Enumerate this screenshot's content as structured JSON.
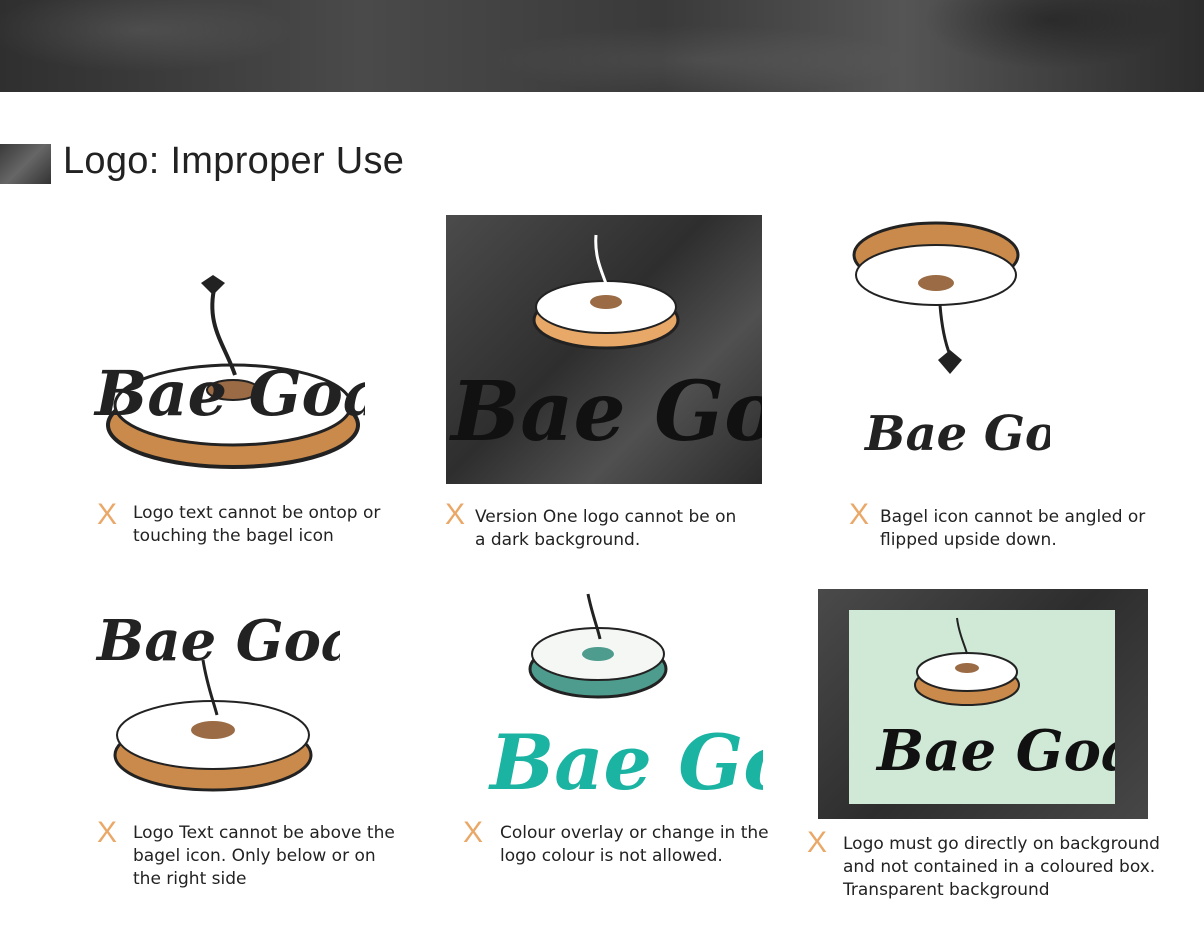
{
  "page": {
    "title": "Logo: Improper Use"
  },
  "logo_text": "Bae Goals",
  "colors": {
    "x_mark": "#eaa868",
    "bagel_crust": "#c98a4b",
    "bagel_cream": "#ffffff",
    "teal": "#1bb3a2",
    "mint_box": "#cfe9d6",
    "dark_background": "#3a3a3a"
  },
  "rules": [
    {
      "mark": "X",
      "text_line1": "Logo text cannot be ontop or",
      "text_line2": "touching the bagel icon",
      "text_line3": ""
    },
    {
      "mark": "X",
      "text_line1": "Version One logo cannot be on",
      "text_line2": "a dark background.",
      "text_line3": ""
    },
    {
      "mark": "X",
      "text_line1": "Bagel icon cannot be angled or",
      "text_line2": "flipped upside down.",
      "text_line3": ""
    },
    {
      "mark": "X",
      "text_line1": "Logo Text cannot be above the",
      "text_line2": "bagel icon. Only below or on",
      "text_line3": "the right side"
    },
    {
      "mark": "X",
      "text_line1": "Colour overlay or change in the",
      "text_line2": "logo colour is not allowed.",
      "text_line3": ""
    },
    {
      "mark": "X",
      "text_line1": "Logo must go directly on background",
      "text_line2": "and not contained in a coloured box.",
      "text_line3": "Transparent background"
    }
  ]
}
